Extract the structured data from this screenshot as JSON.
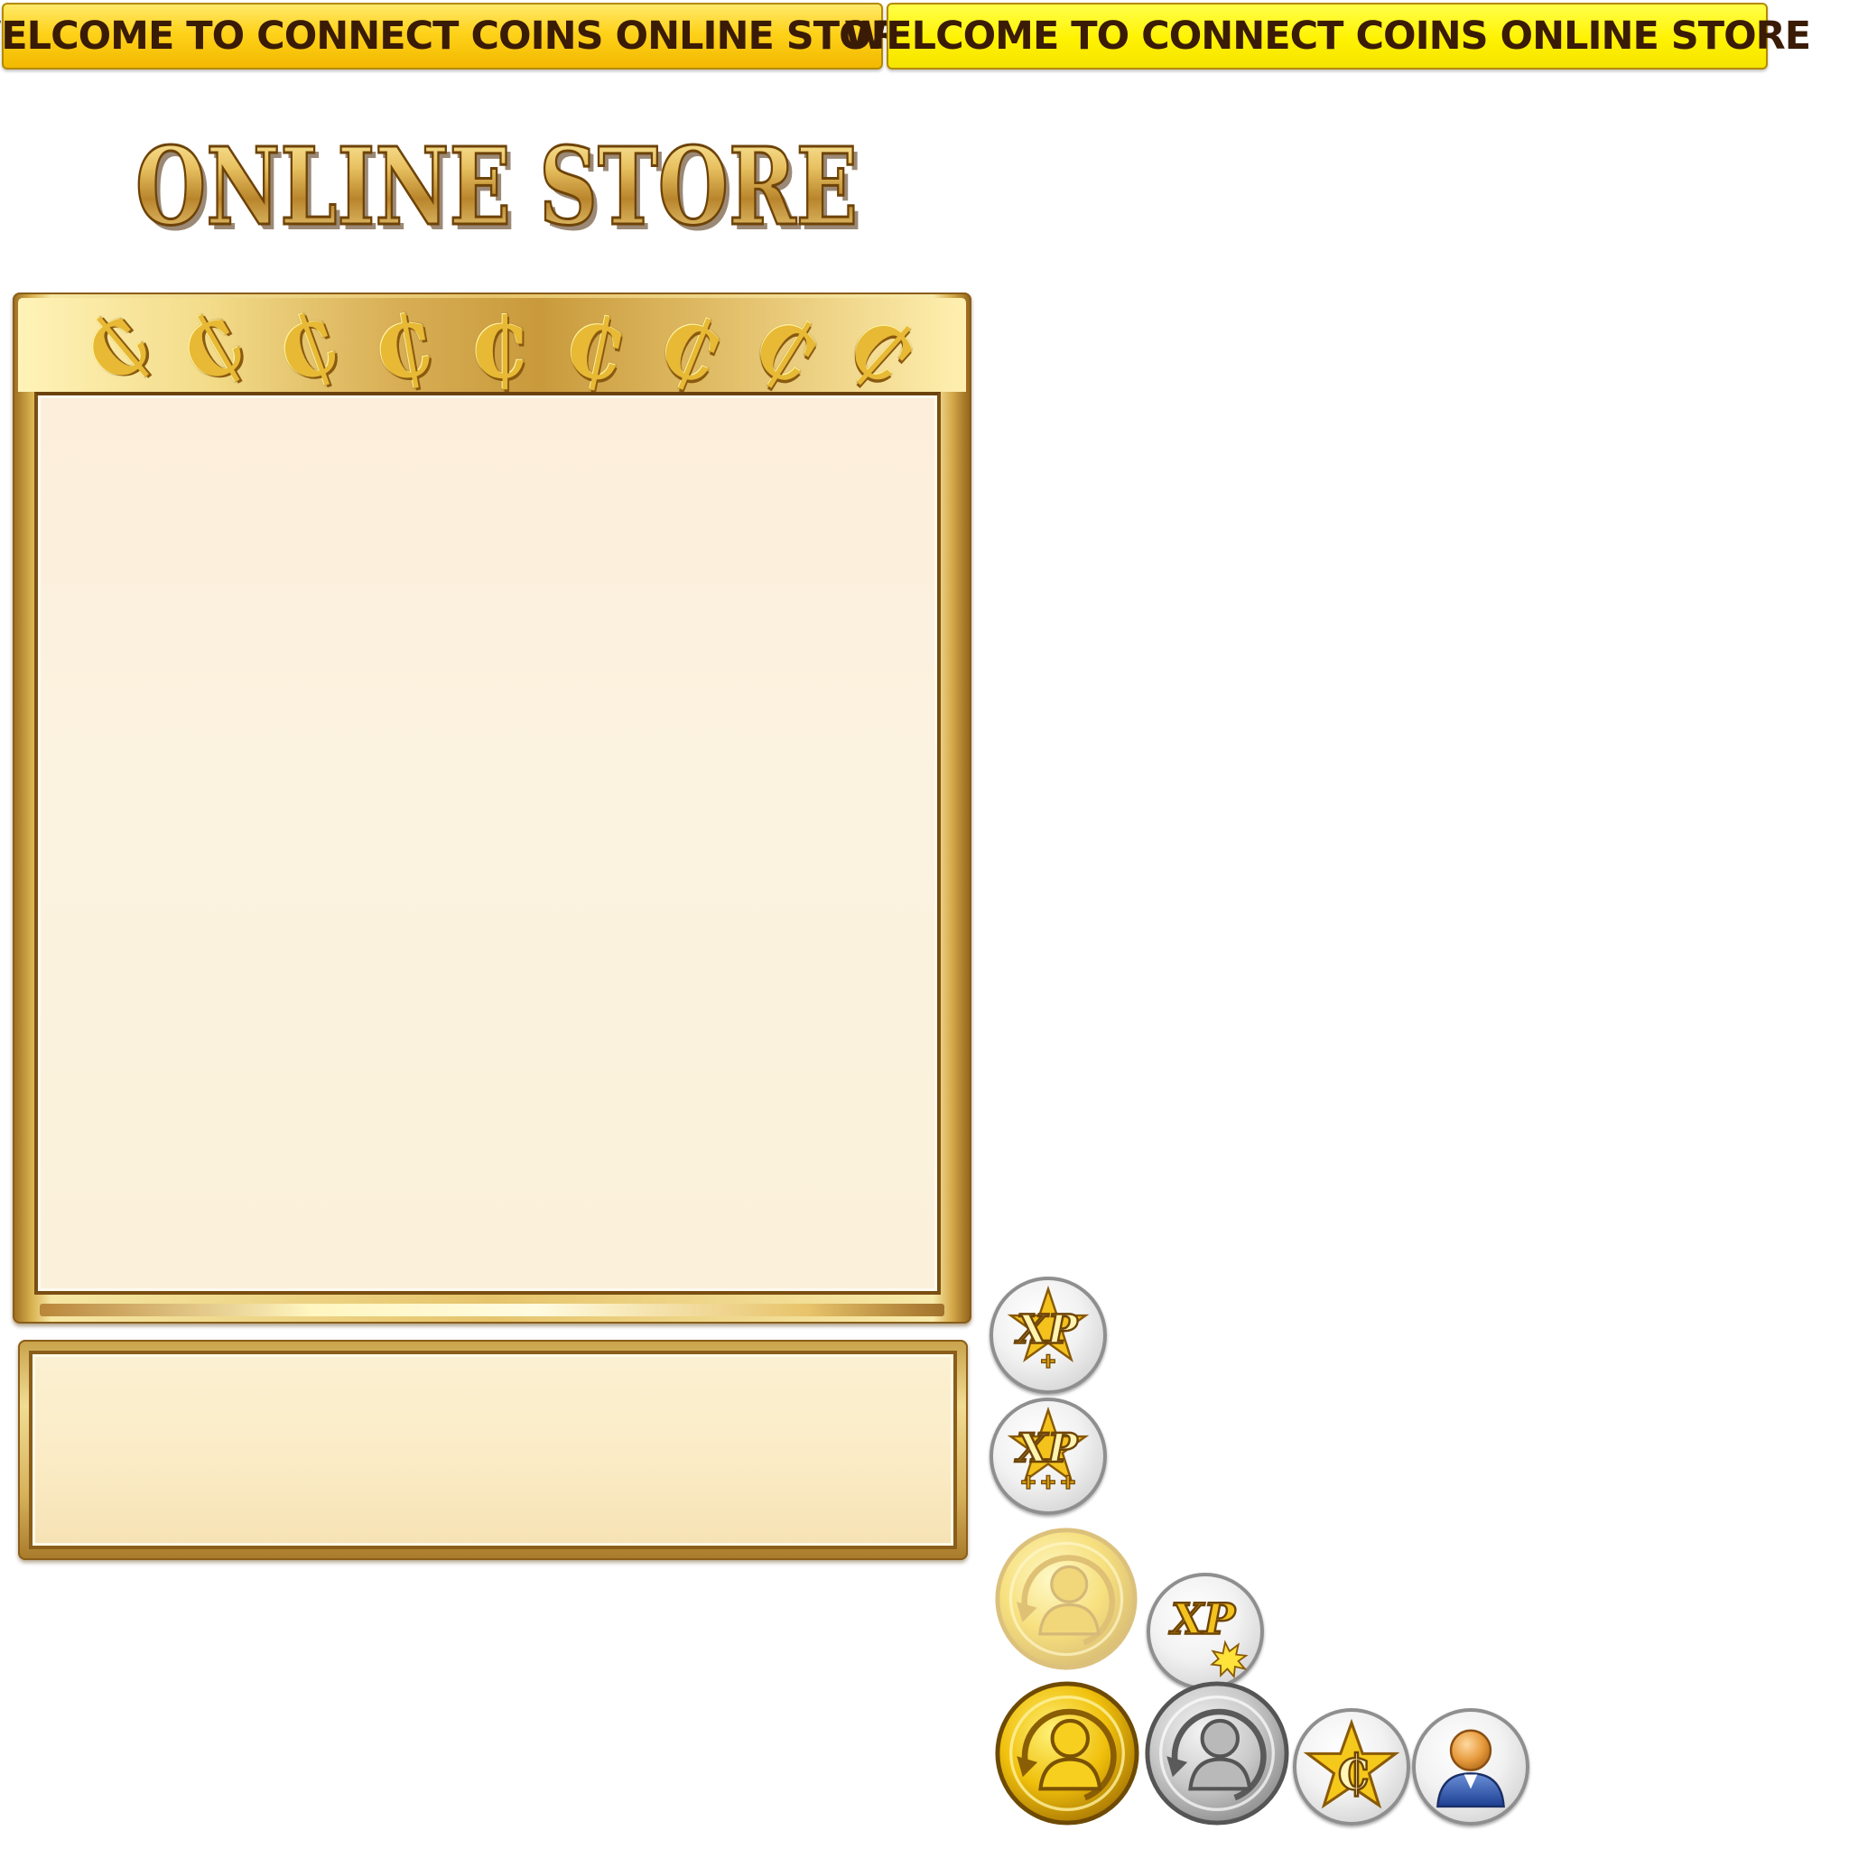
{
  "banners": {
    "banner_1": "WELCOME TO CONNECT COINS ONLINE STORE",
    "banner_2": "WELCOME TO CONNECT COINS ONLINE STORE"
  },
  "logo": {
    "text": "ONLINE STORE"
  },
  "main_panel": {
    "coin_symbol": "₵",
    "coin_count": 9
  },
  "icons": {
    "xp_plus": {
      "label": "XP",
      "icon": "xp-plus-icon"
    },
    "xp_triple_plus": {
      "label": "XP",
      "icon": "xp-triple-plus-icon"
    },
    "xp_burst": {
      "label": "XP",
      "icon": "xp-burst-icon"
    },
    "gold_refresh_light": {
      "icon": "gold-user-refresh-faded-icon"
    },
    "gold_refresh": {
      "icon": "gold-user-refresh-icon"
    },
    "silver_refresh": {
      "icon": "silver-user-refresh-icon"
    },
    "coin_star": {
      "label": "₵",
      "icon": "coin-star-icon"
    },
    "user_avatar": {
      "icon": "user-avatar-icon"
    }
  },
  "colors": {
    "banner_1_bg": "#ffd21a",
    "banner_2_bg": "#fff200",
    "banner_text": "#3a1b05",
    "gold": "#e2b64a",
    "panel_fill": "#fbf3e0"
  }
}
